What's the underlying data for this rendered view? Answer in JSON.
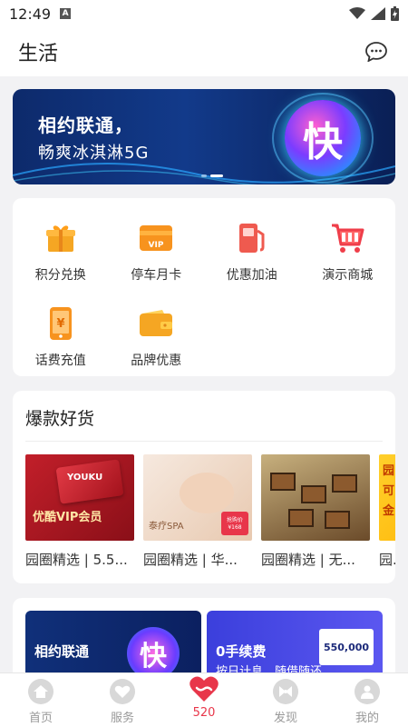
{
  "status_bar": {
    "time": "12:49",
    "badge": "A"
  },
  "header": {
    "title": "生活"
  },
  "banner": {
    "line1": "相约联通，",
    "line2": "畅爽冰淇淋5G",
    "badge": "快"
  },
  "services": [
    {
      "label": "积分兑换",
      "icon": "gift-icon",
      "color": "#f5a623"
    },
    {
      "label": "停车月卡",
      "icon": "vip-card-icon",
      "color": "#f7931e"
    },
    {
      "label": "优惠加油",
      "icon": "fuel-pump-icon",
      "color": "#ef5a4f"
    },
    {
      "label": "演示商城",
      "icon": "shopping-cart-icon",
      "color": "#ef3e4a"
    },
    {
      "label": "话费充值",
      "icon": "phone-recharge-icon",
      "color": "#f7931e"
    },
    {
      "label": "品牌优惠",
      "icon": "wallet-icon",
      "color": "#f5a623"
    }
  ],
  "hot": {
    "title": "爆款好货",
    "items": [
      {
        "caption": "园圈精选 | 5.5..."
      },
      {
        "caption": "园圈精选 | 华..."
      },
      {
        "caption": "园圈精选 | 无..."
      },
      {
        "caption": "园..."
      }
    ],
    "img_text": {
      "vip": "优酷VIP会员",
      "vip_card": "YOUKU",
      "spa": "泰疗SPA",
      "spa_price": "抢购价 ¥168",
      "yellow": "园 可 金"
    }
  },
  "promo": {
    "a_text": "相约联通",
    "a_badge": "快",
    "b_title": "0手续费",
    "b_sub": "按日计息，随借随还",
    "b_amount": "550,000"
  },
  "tabbar": [
    {
      "label": "首页",
      "icon": "home-icon",
      "active": false
    },
    {
      "label": "服务",
      "icon": "service-heart-icon",
      "active": false
    },
    {
      "label": "520",
      "icon": "heart-520-icon",
      "active": true
    },
    {
      "label": "发现",
      "icon": "discover-bow-icon",
      "active": false
    },
    {
      "label": "我的",
      "icon": "profile-icon",
      "active": false
    }
  ],
  "colors": {
    "accent": "#e8364a",
    "banner_bg": "#0d2a6b"
  }
}
